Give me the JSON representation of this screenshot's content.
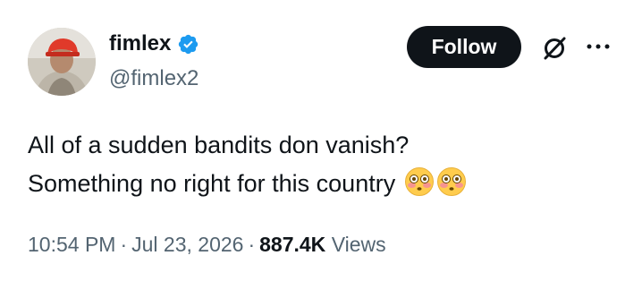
{
  "author": {
    "display_name": "fimlex",
    "handle": "@fimlex2",
    "verified": true
  },
  "actions": {
    "follow_label": "Follow"
  },
  "tweet": {
    "line1": "All of a sudden bandits don vanish?",
    "line2": "Something no right for this country",
    "emojis": [
      "flushed-face",
      "flushed-face"
    ]
  },
  "meta": {
    "time": "10:54 PM",
    "date": "Jul 23, 2026",
    "separator": "·",
    "views_count": "887.4K",
    "views_label": "Views"
  },
  "colors": {
    "accent_verified": "#1d9bf0",
    "primary_text": "#0f1419",
    "secondary_text": "#536471",
    "button_bg": "#0f1419"
  }
}
